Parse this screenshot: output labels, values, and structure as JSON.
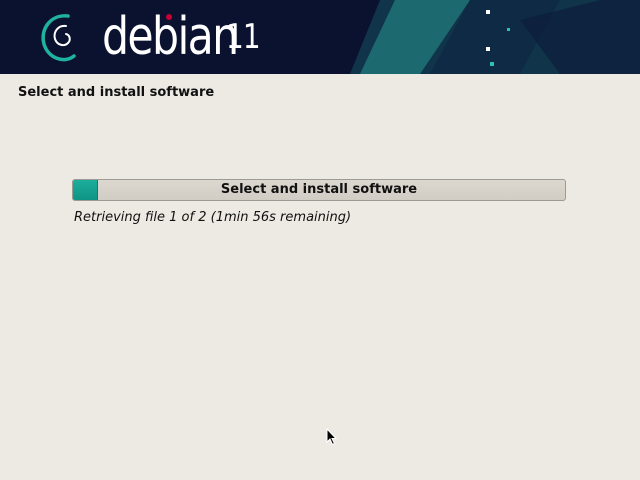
{
  "banner": {
    "logo_text": "debian",
    "version": "11"
  },
  "page": {
    "title": "Select and install software"
  },
  "progress": {
    "label": "Select and install software",
    "fraction": 0.05,
    "status": "Retrieving file 1 of 2 (1min 56s remaining)"
  },
  "colors": {
    "banner_bg": "#0b1230",
    "accent_teal": "#13a08f",
    "logo_dot": "#c70036",
    "page_bg": "#edeae4"
  }
}
